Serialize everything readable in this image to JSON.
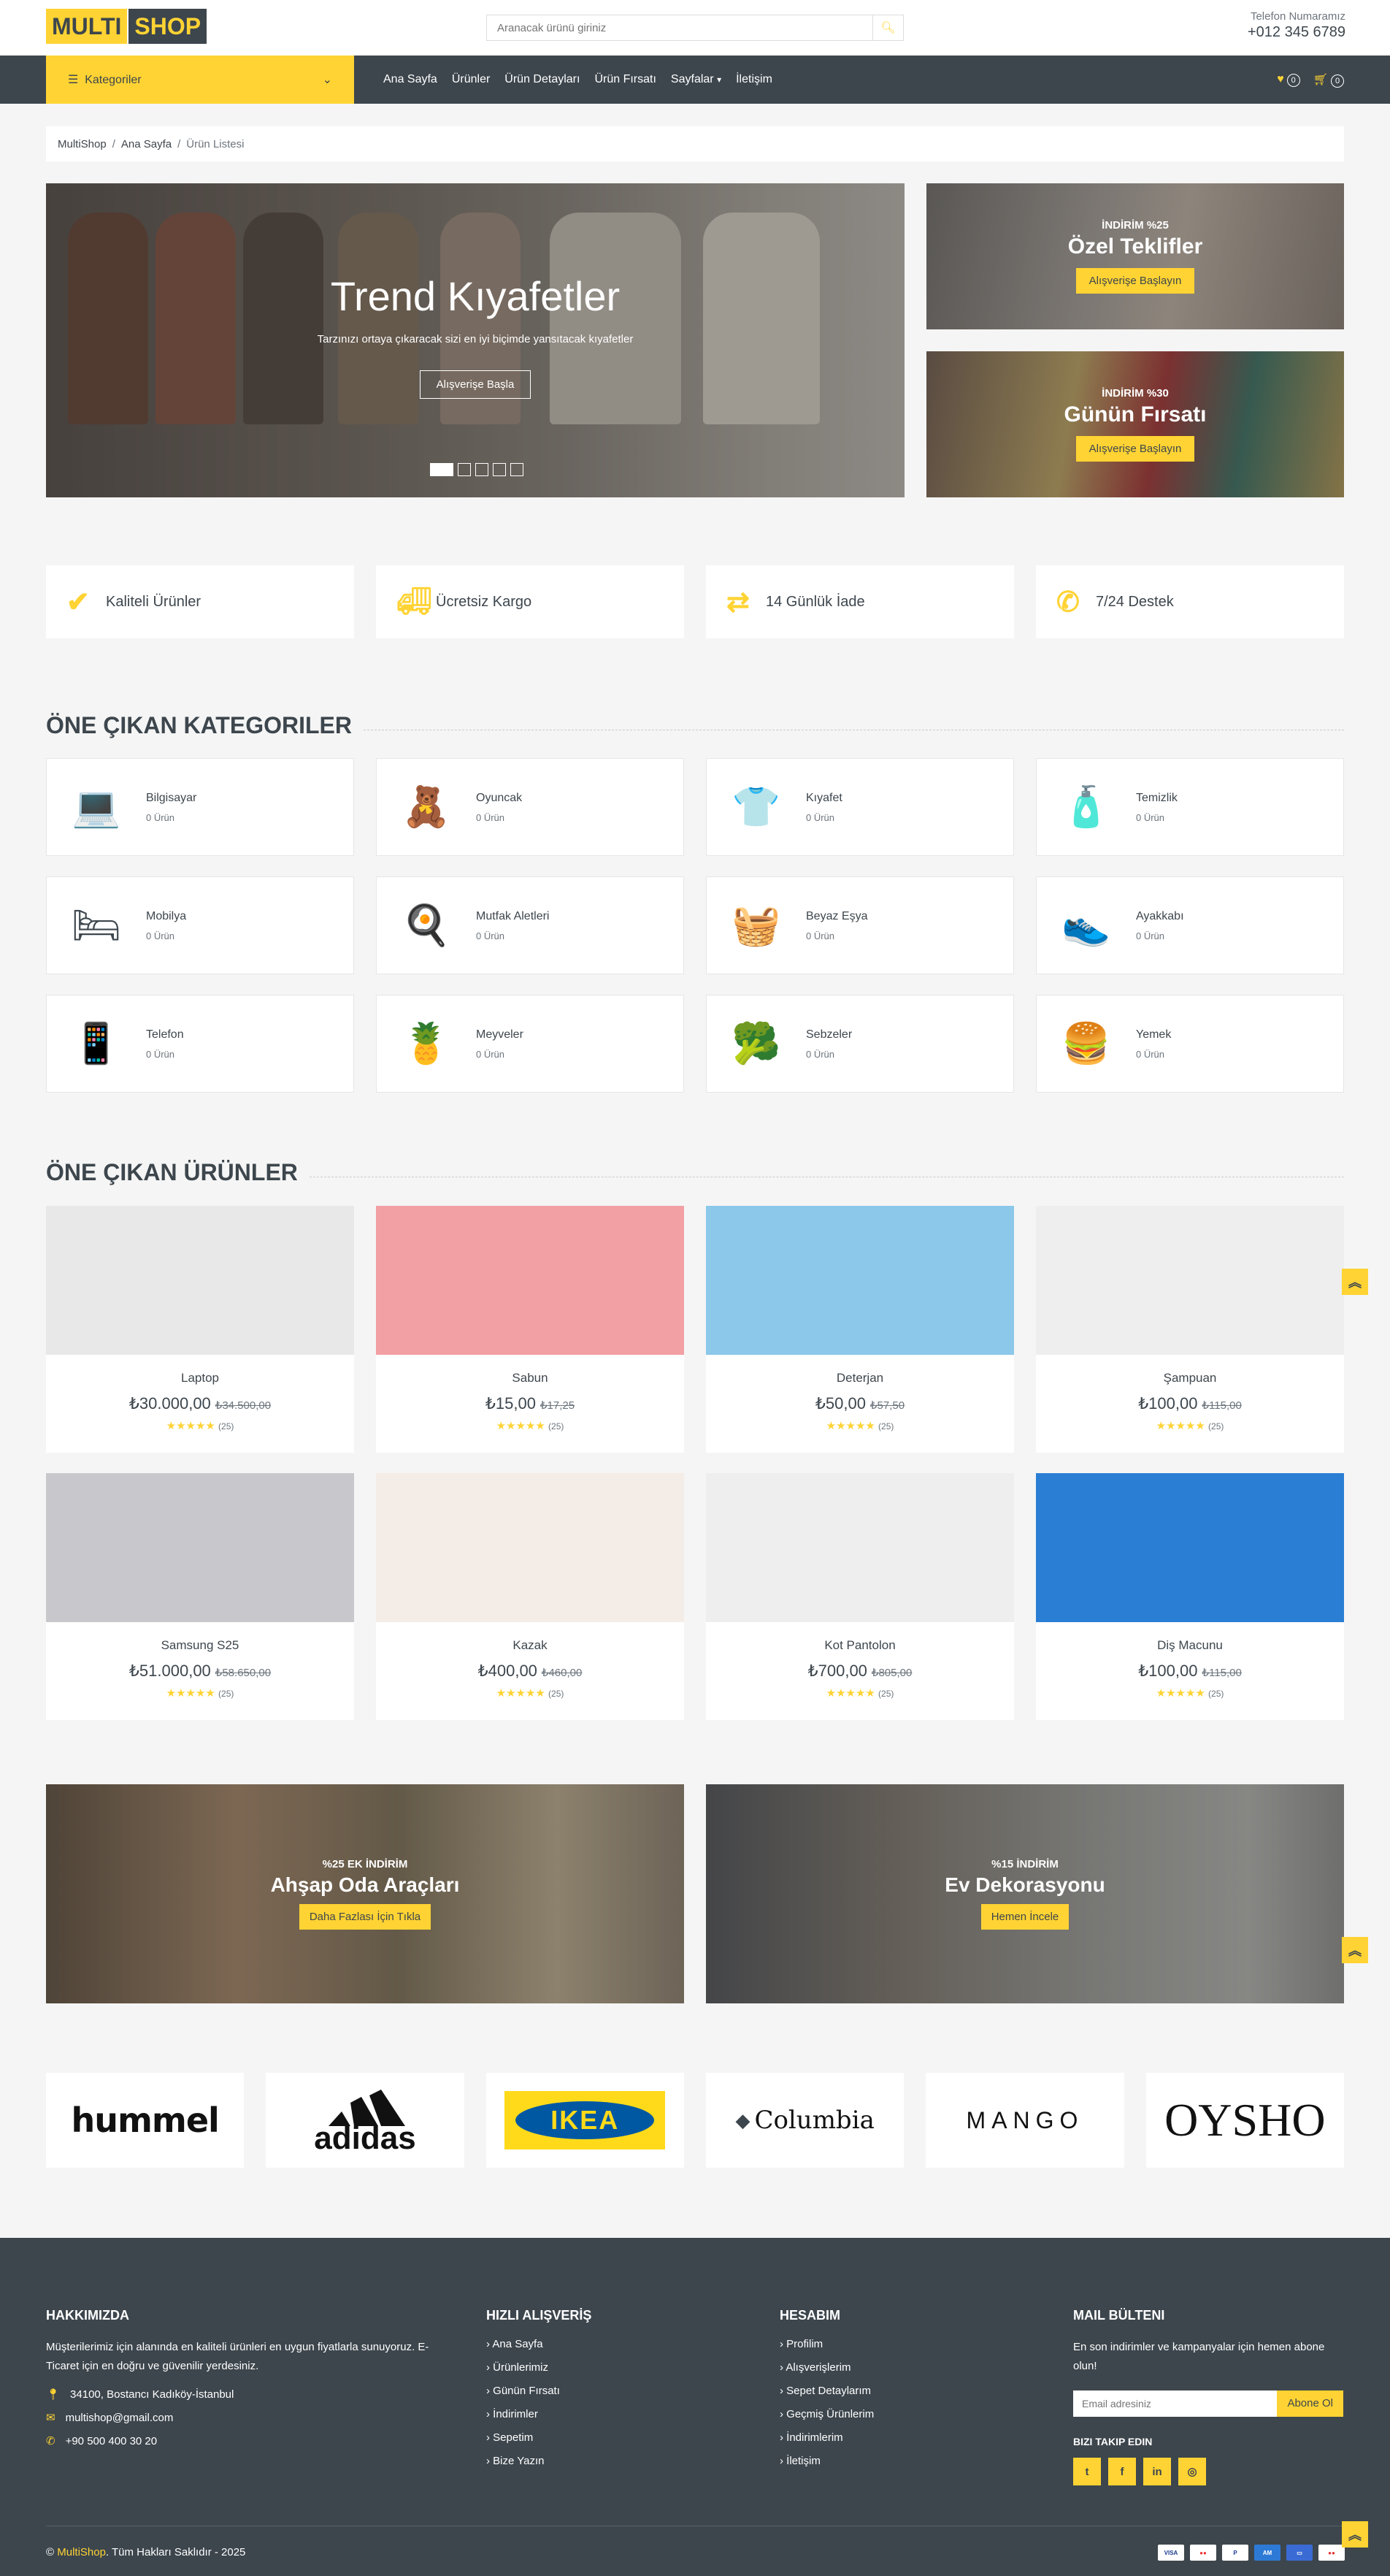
{
  "header": {
    "logo_part1": "MULTI",
    "logo_part2": "SHOP",
    "search_placeholder": "Aranacak ürünü giriniz",
    "phone_label": "Telefon Numaramız",
    "phone_number": "+012 345 6789"
  },
  "nav": {
    "categories_label": "Kategoriler",
    "links": [
      "Ana Sayfa",
      "Ürünler",
      "Ürün Detayları",
      "Ürün Fırsatı",
      "Sayfalar",
      "İletişim"
    ],
    "wishlist_count": "0",
    "cart_count": "0"
  },
  "breadcrumb": [
    "MultiShop",
    "Ana Sayfa",
    "Ürün Listesi"
  ],
  "hero": {
    "title": "Trend Kıyafetler",
    "subtitle": "Tarzınızı ortaya çıkaracak sizi en iyi biçimde yansıtacak kıyafetler",
    "button": "Alışverişe Başla",
    "slides": 5
  },
  "offers": [
    {
      "discount": "İNDİRİM %25",
      "title": "Özel Teklifler",
      "button": "Alışverişe Başlayın"
    },
    {
      "discount": "İNDİRİM %30",
      "title": "Günün Fırsatı",
      "button": "Alışverişe Başlayın"
    }
  ],
  "features": [
    {
      "icon": "check-icon",
      "label": "Kaliteli Ürünler"
    },
    {
      "icon": "truck-icon",
      "label": "Ücretsiz Kargo"
    },
    {
      "icon": "exchange-icon",
      "label": "14 Günlük İade"
    },
    {
      "icon": "phone-volume-icon",
      "label": "7/24 Destek"
    }
  ],
  "categories_title": "ÖNE ÇIKAN KATEGORILER",
  "categories": [
    {
      "name": "Bilgisayar",
      "count": "0 Ürün",
      "icon": "💻"
    },
    {
      "name": "Oyuncak",
      "count": "0 Ürün",
      "icon": "🧸"
    },
    {
      "name": "Kıyafet",
      "count": "0 Ürün",
      "icon": "👕"
    },
    {
      "name": "Temizlik",
      "count": "0 Ürün",
      "icon": "🧴"
    },
    {
      "name": "Mobilya",
      "count": "0 Ürün",
      "icon": "🛏"
    },
    {
      "name": "Mutfak Aletleri",
      "count": "0 Ürün",
      "icon": "🍳"
    },
    {
      "name": "Beyaz Eşya",
      "count": "0 Ürün",
      "icon": "🧺"
    },
    {
      "name": "Ayakkabı",
      "count": "0 Ürün",
      "icon": "👟"
    },
    {
      "name": "Telefon",
      "count": "0 Ürün",
      "icon": "📱"
    },
    {
      "name": "Meyveler",
      "count": "0 Ürün",
      "icon": "🍍"
    },
    {
      "name": "Sebzeler",
      "count": "0 Ürün",
      "icon": "🥦"
    },
    {
      "name": "Yemek",
      "count": "0 Ürün",
      "icon": "🍔"
    }
  ],
  "products_title": "ÖNE ÇIKAN ÜRÜNLER",
  "products": [
    {
      "name": "Laptop",
      "price": "₺30.000,00",
      "old_price": "₺34.500,00",
      "rating": 5,
      "reviews": "(25)",
      "color": "#e8e8e8"
    },
    {
      "name": "Sabun",
      "price": "₺15,00",
      "old_price": "₺17,25",
      "rating": 5,
      "reviews": "(25)",
      "color": "#f2a0a4"
    },
    {
      "name": "Deterjan",
      "price": "₺50,00",
      "old_price": "₺57,50",
      "rating": 5,
      "reviews": "(25)",
      "color": "#8cc8ea"
    },
    {
      "name": "Şampuan",
      "price": "₺100,00",
      "old_price": "₺115,00",
      "rating": 5,
      "reviews": "(25)",
      "color": "#eeeeee"
    },
    {
      "name": "Samsung S25",
      "price": "₺51.000,00",
      "old_price": "₺58.650,00",
      "rating": 5,
      "reviews": "(25)",
      "color": "#c8c8cc"
    },
    {
      "name": "Kazak",
      "price": "₺400,00",
      "old_price": "₺460,00",
      "rating": 5,
      "reviews": "(25)",
      "color": "#f4ece6"
    },
    {
      "name": "Kot Pantolon",
      "price": "₺700,00",
      "old_price": "₺805,00",
      "rating": 5,
      "reviews": "(25)",
      "color": "#eeeeee"
    },
    {
      "name": "Diş Macunu",
      "price": "₺100,00",
      "old_price": "₺115,00",
      "rating": 5,
      "reviews": "(25)",
      "color": "#2a7fd4"
    }
  ],
  "banners": [
    {
      "discount": "%25 EK İNDİRİM",
      "title": "Ahşap Oda Araçları",
      "button": "Daha Fazlası İçin Tıkla"
    },
    {
      "discount": "%15 İNDİRİM",
      "title": "Ev Dekorasyonu",
      "button": "Hemen İncele"
    }
  ],
  "brands": [
    "hummel",
    "adidas",
    "IKEA",
    "Columbia",
    "MANGO",
    "OYSHO"
  ],
  "footer": {
    "about_title": "HAKKIMIZDA",
    "about_text": "Müşterilerimiz için alanında en kaliteli ürünleri en uygun fiyatlarla sunuyoruz. E-Ticaret için en doğru ve güvenilir yerdesiniz.",
    "address": "34100, Bostancı Kadıköy-İstanbul",
    "email": "multishop@gmail.com",
    "phone": "+90 500 400 30 20",
    "quick_title": "HIZLI ALIŞVERİŞ",
    "quick_links": [
      "Ana Sayfa",
      "Ürünlerimiz",
      "Günün Fırsatı",
      "İndirimler",
      "Sepetim",
      "Bize Yazın"
    ],
    "account_title": "HESABIM",
    "account_links": [
      "Profilim",
      "Alışverişlerim",
      "Sepet Detaylarım",
      "Geçmiş Ürünlerim",
      "İndirimlerim",
      "İletişim"
    ],
    "newsletter_title": "MAIL BÜLTENI",
    "newsletter_text": "En son indirimler ve kampanyalar için hemen abone olun!",
    "email_placeholder": "Email adresiniz",
    "subscribe": "Abone Ol",
    "follow_title": "BIZI TAKIP EDIN",
    "copyright_brand": "MultiShop",
    "copyright_text": ". Tüm Hakları Saklıdır - 2025",
    "copyright_symbol": "©"
  },
  "colors": {
    "accent": "#ffd333",
    "dark": "#3d464d",
    "light": "#f5f5f5"
  }
}
